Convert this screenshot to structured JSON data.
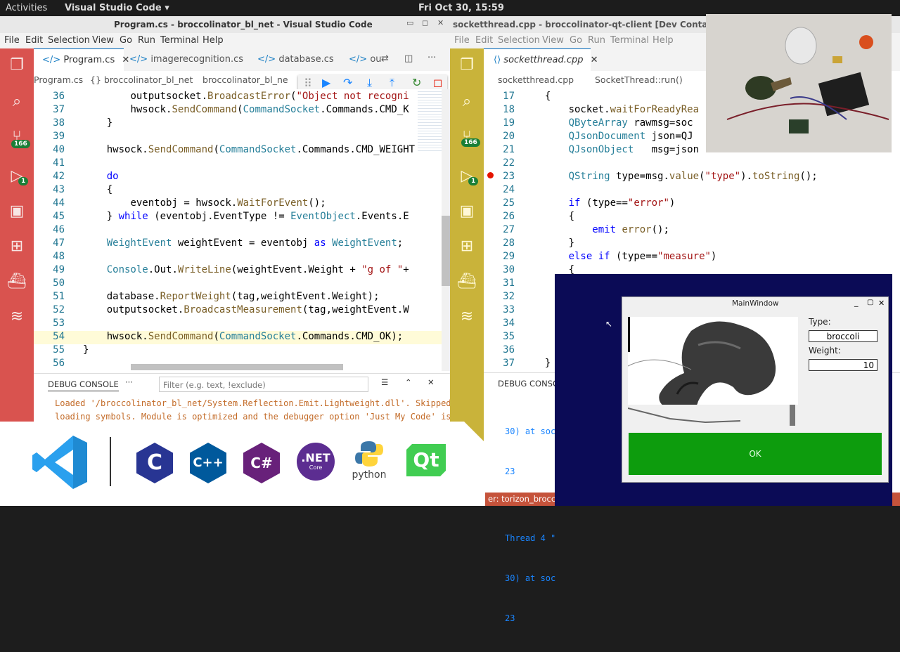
{
  "topbar": {
    "activities": "Activities",
    "app_menu": "Visual Studio Code ▾",
    "clock": "Fri Oct 30, 15:59"
  },
  "left_window": {
    "title": "Program.cs - broccolinator_bl_net - Visual Studio Code",
    "menu": [
      "File",
      "Edit",
      "Selection",
      "View",
      "Go",
      "Run",
      "Terminal",
      "Help"
    ],
    "tabs": [
      "Program.cs",
      "imagerecognition.cs",
      "database.cs",
      "ou"
    ],
    "breadcrumb": [
      "Program.cs",
      "{} broccolinator_bl_net",
      "broccolinator_bl_ne"
    ],
    "badges": [
      "166",
      "1"
    ],
    "lines": [
      {
        "n": "36",
        "text": "        outputsocket.BroadcastError(\"Object not recogni"
      },
      {
        "n": "37",
        "text": "        hwsock.SendCommand(CommandSocket.Commands.CMD_K"
      },
      {
        "n": "38",
        "text": "    }"
      },
      {
        "n": "39",
        "text": ""
      },
      {
        "n": "40",
        "text": "    hwsock.SendCommand(CommandSocket.Commands.CMD_WEIGHT"
      },
      {
        "n": "41",
        "text": ""
      },
      {
        "n": "42",
        "text": "    do"
      },
      {
        "n": "43",
        "text": "    {"
      },
      {
        "n": "44",
        "text": "        eventobj = hwsock.WaitForEvent();"
      },
      {
        "n": "45",
        "text": "    } while (eventobj.EventType != EventObject.Events.E"
      },
      {
        "n": "46",
        "text": ""
      },
      {
        "n": "47",
        "text": "    WeightEvent weightEvent = eventobj as WeightEvent;"
      },
      {
        "n": "48",
        "text": ""
      },
      {
        "n": "49",
        "text": "    Console.Out.WriteLine(weightEvent.Weight + \"g of \"+"
      },
      {
        "n": "50",
        "text": ""
      },
      {
        "n": "51",
        "text": "    database.ReportWeight(tag,weightEvent.Weight);"
      },
      {
        "n": "52",
        "text": "    outputsocket.BroadcastMeasurement(tag,weightEvent.W"
      },
      {
        "n": "53",
        "text": ""
      },
      {
        "n": "54",
        "text": "    hwsock.SendCommand(CommandSocket.Commands.CMD_OK);"
      },
      {
        "n": "55",
        "text": "}"
      },
      {
        "n": "56",
        "text": ""
      }
    ],
    "debug_console_label": "DEBUG CONSOLE",
    "filter_placeholder": "Filter (e.g. text, !exclude)",
    "console_lines": [
      "Loaded '/broccolinator_bl_net/System.Reflection.Emit.Lightweight.dll'. Skipped",
      "loading symbols. Module is optimized and the debugger option 'Just My Code' is"
    ]
  },
  "right_window": {
    "title": "socketthread.cpp - broccolinator-qt-client [Dev Container: tori",
    "menu": [
      "File",
      "Edit",
      "Selection",
      "View",
      "Go",
      "Run",
      "Terminal",
      "Help"
    ],
    "tabs": [
      "socketthread.cpp"
    ],
    "breadcrumb": [
      "socketthread.cpp",
      "SocketThread::run()"
    ],
    "badges": [
      "166",
      "1"
    ],
    "lines": [
      {
        "n": "17",
        "text": "  {"
      },
      {
        "n": "18",
        "text": "      socket.waitForReadyRea"
      },
      {
        "n": "19",
        "text": "      QByteArray rawmsg=soc"
      },
      {
        "n": "20",
        "text": "      QJsonDocument json=QJ"
      },
      {
        "n": "21",
        "text": "      QJsonObject   msg=json"
      },
      {
        "n": "22",
        "text": ""
      },
      {
        "n": "23",
        "text": "      QString type=msg.value(\"type\").toString();"
      },
      {
        "n": "24",
        "text": ""
      },
      {
        "n": "25",
        "text": "      if (type==\"error\")"
      },
      {
        "n": "26",
        "text": "      {"
      },
      {
        "n": "27",
        "text": "          emit error();"
      },
      {
        "n": "28",
        "text": "      }"
      },
      {
        "n": "29",
        "text": "      else if (type==\"measure\")"
      },
      {
        "n": "30",
        "text": "      {"
      },
      {
        "n": "31",
        "text": ""
      },
      {
        "n": "32",
        "text": ""
      },
      {
        "n": "33",
        "text": ""
      },
      {
        "n": "34",
        "text": ""
      },
      {
        "n": "35",
        "text": ""
      },
      {
        "n": "36",
        "text": ""
      },
      {
        "n": "37",
        "text": "  }"
      }
    ],
    "debug_console_label": "DEBUG CONSOL",
    "console_lines": [
      "30) at soc",
      "23",
      "",
      "Thread 4 \"",
      "30) at soc",
      "23"
    ],
    "status_text": "er: torizon_broccolinator-qt...   first-commit   ⊗ 0 ⚠ 0   C++ Launch (broccolinator_cl"
  },
  "main_window": {
    "title": "MainWindow",
    "type_label": "Type:",
    "type_value": "broccoli",
    "weight_label": "Weight:",
    "weight_value": "10",
    "ok_label": "OK"
  },
  "logos": {
    "net_label": ".NET",
    "net_sub": "Core",
    "python_label": "python",
    "qt_label": "Qt",
    "c_label": "C",
    "cpp_label": "C++",
    "cs_label": "C#"
  }
}
